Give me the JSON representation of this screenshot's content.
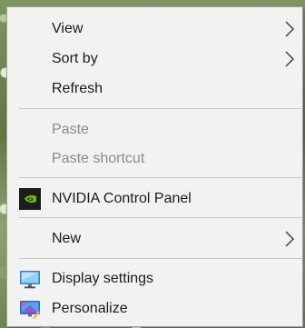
{
  "context_menu": {
    "items": [
      {
        "label": "View",
        "submenu": true,
        "enabled": true
      },
      {
        "label": "Sort by",
        "submenu": true,
        "enabled": true
      },
      {
        "label": "Refresh",
        "submenu": false,
        "enabled": true
      },
      {
        "label": "Paste",
        "submenu": false,
        "enabled": false
      },
      {
        "label": "Paste shortcut",
        "submenu": false,
        "enabled": false
      },
      {
        "label": "NVIDIA Control Panel",
        "submenu": false,
        "enabled": true,
        "icon": "nvidia-icon"
      },
      {
        "label": "New",
        "submenu": true,
        "enabled": true
      },
      {
        "label": "Display settings",
        "submenu": false,
        "enabled": true,
        "icon": "display-settings-icon"
      },
      {
        "label": "Personalize",
        "submenu": false,
        "enabled": true,
        "icon": "personalize-icon"
      }
    ]
  },
  "colors": {
    "menu_background": "#f2f2f2",
    "text": "#1a1a1a",
    "disabled_text": "#8a8a8a",
    "separator": "#c8c8c8",
    "nvidia_green": "#76b900"
  }
}
